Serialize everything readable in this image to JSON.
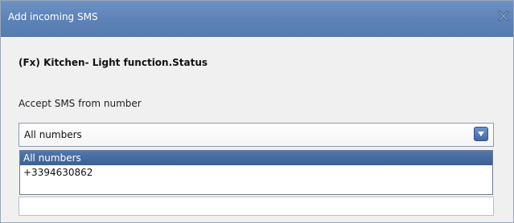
{
  "window": {
    "title": "Add incoming SMS",
    "close_icon": "close-icon"
  },
  "main": {
    "subject": "(Fx) Kitchen- Light function.Status",
    "accept_label": "Accept SMS from number",
    "combo": {
      "selected_value": "All numbers",
      "button_icon": "chevron-down-icon"
    },
    "dropdown_options": [
      {
        "label": "All numbers",
        "selected": true
      },
      {
        "label": "+3394630862",
        "selected": false
      }
    ]
  },
  "colors": {
    "titlebar": "#5c82b7",
    "selected_option": "#4a6ea3",
    "dialog_background": "#f0f0f0"
  }
}
